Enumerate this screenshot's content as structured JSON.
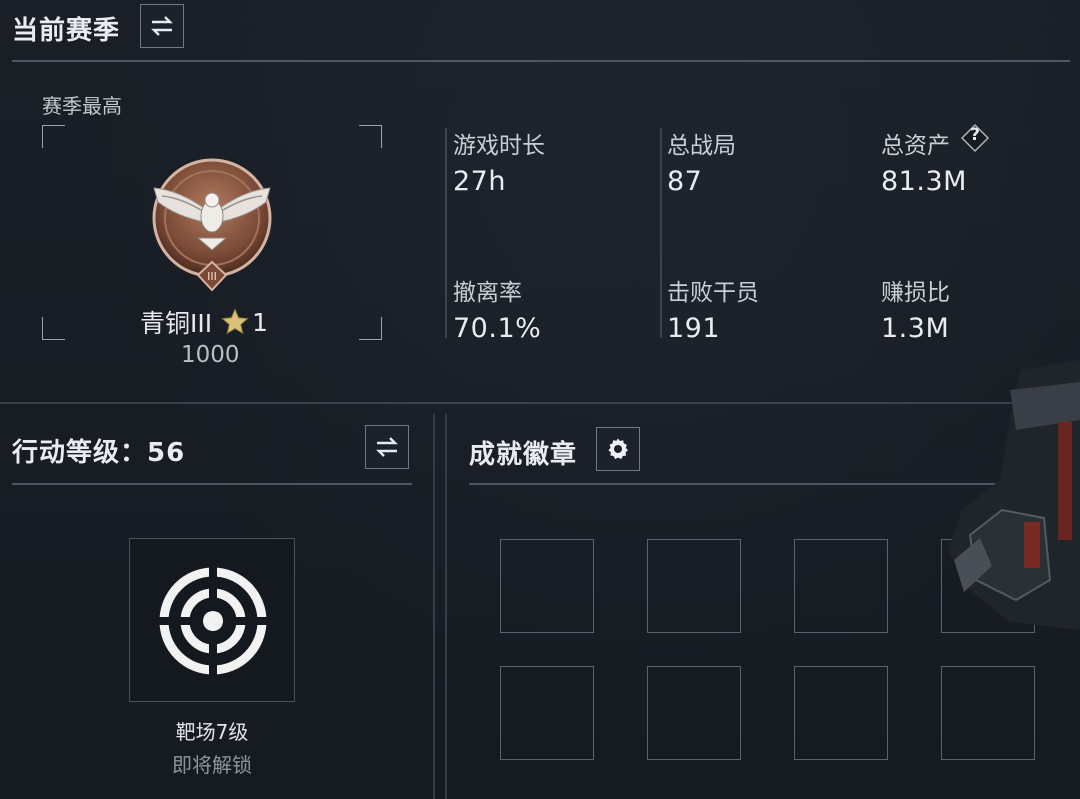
{
  "season": {
    "title": "当前赛季",
    "best_label": "赛季最高",
    "rank_name": "青铜III",
    "rank_stars": "1",
    "rank_points": "1000",
    "stats": [
      {
        "label": "游戏时长",
        "value": "27h"
      },
      {
        "label": "总战局",
        "value": "87"
      },
      {
        "label": "总资产",
        "value": "81.3M"
      },
      {
        "label": "撤离率",
        "value": "70.1%"
      },
      {
        "label": "击败干员",
        "value": "191"
      },
      {
        "label": "赚损比",
        "value": "1.3M"
      }
    ],
    "help_icon_glyph": "?"
  },
  "action_level": {
    "title": "行动等级：56",
    "unlock_name": "靶场7级",
    "unlock_status": "即将解锁"
  },
  "achievements": {
    "title": "成就徽章",
    "slot_count": 8
  },
  "icons": {
    "swap": "swap-icon",
    "gear": "gear-icon",
    "help": "help-icon",
    "target": "target-icon",
    "rank_badge": "bronze-eagle-badge",
    "star": "star-icon"
  },
  "colors": {
    "background": "#171c24",
    "bronze": "#8a5a42",
    "star": "#d8c27a",
    "text": "#e9edf1"
  }
}
